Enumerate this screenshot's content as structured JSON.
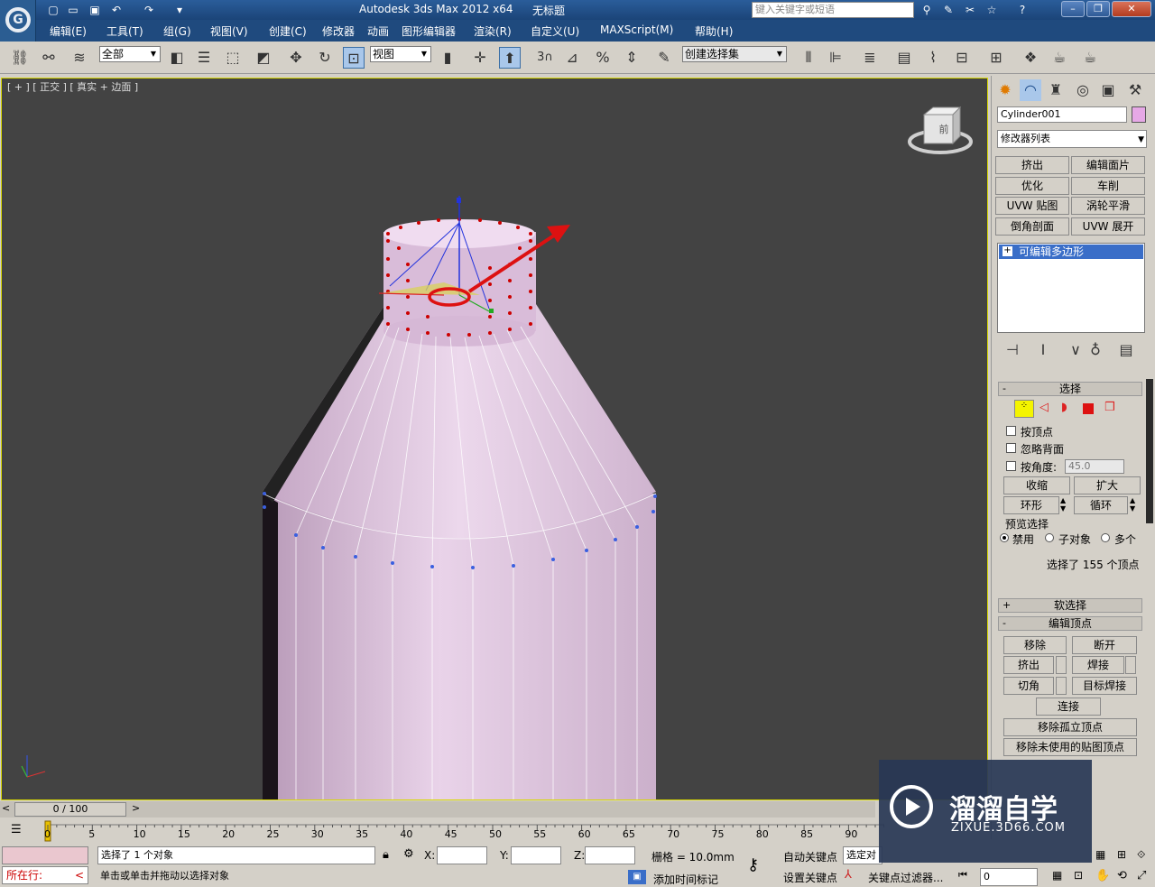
{
  "app": {
    "title": "Autodesk 3ds Max  2012 x64",
    "document": "无标题",
    "search_placeholder": "键入关键字或短语"
  },
  "menu": [
    "编辑(E)",
    "工具(T)",
    "组(G)",
    "视图(V)",
    "创建(C)",
    "修改器",
    "动画",
    "图形编辑器",
    "渲染(R)",
    "自定义(U)",
    "MAXScript(M)",
    "帮助(H)"
  ],
  "toolbar": {
    "filter_select": "全部",
    "ref_coord_select": "视图",
    "named_selection": "创建选择集",
    "snap_label": "3"
  },
  "viewport": {
    "label": "[ + ] [ 正交 ] [ 真实 + 边面 ]",
    "label_parts": [
      "[ + ]",
      "正交",
      "真实 + 边面 ]"
    ],
    "viewcube_face": "前"
  },
  "command_panel": {
    "object_name": "Cylinder001",
    "object_color": "#e6a8e6",
    "modifier_list": "修改器列表",
    "modifier_buttons": [
      "挤出",
      "编辑面片",
      "优化",
      "车削",
      "UVW 贴图",
      "涡轮平滑",
      "倒角剖面",
      "UVW 展开"
    ],
    "stack_item": "可编辑多边形",
    "selection": {
      "title": "选择",
      "by_vertex": "按顶点",
      "ignore_backfacing": "忽略背面",
      "by_angle": "按角度:",
      "angle_value": "45.0",
      "shrink": "收缩",
      "grow": "扩大",
      "ring": "环形",
      "loop": "循环",
      "preview_title": "预览选择",
      "preview_options": [
        "禁用",
        "子对象",
        "多个"
      ],
      "status": "选择了 155 个顶点"
    },
    "soft_selection": "软选择",
    "edit_vertices": {
      "title": "编辑顶点",
      "remove": "移除",
      "break": "断开",
      "extrude": "挤出",
      "weld": "焊接",
      "chamfer": "切角",
      "target_weld": "目标焊接",
      "connect": "连接",
      "remove_isolated": "移除孤立顶点",
      "remove_unused_map": "移除未使用的贴图顶点"
    }
  },
  "timeline": {
    "frame_counter": "0 / 100",
    "ticks": [
      "0",
      "5",
      "10",
      "15",
      "20",
      "25",
      "30",
      "35",
      "40",
      "45",
      "50",
      "55",
      "60",
      "65",
      "70",
      "75",
      "80",
      "85",
      "90"
    ]
  },
  "status": {
    "selected": "选择了 1 个对象",
    "prompt": "单击或单击并拖动以选择对象",
    "running": "所在行:",
    "x_label": "X:",
    "y_label": "Y:",
    "z_label": "Z:",
    "grid": "栅格 = 10.0mm",
    "auto_key": "自动关键点",
    "set_key": "设置关键点",
    "selected_object": "选定对",
    "key_filters": "关键点过滤器...",
    "add_time_tag": "添加时间标记",
    "frame": "0"
  },
  "watermark": {
    "name": "溜溜自学",
    "url": "ZIXUE.3D66.COM"
  }
}
